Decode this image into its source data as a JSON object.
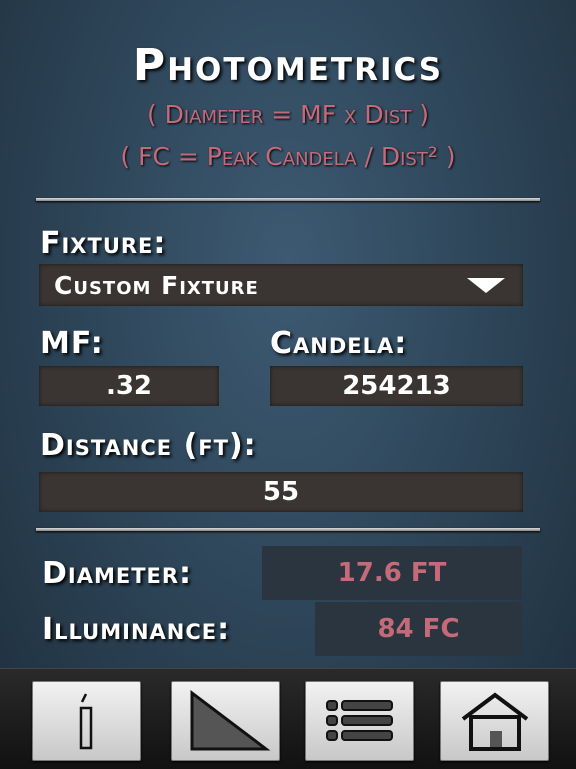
{
  "header": {
    "title": "Photometrics",
    "formula_diameter": "( Diameter = MF x Dist )",
    "formula_fc": "( FC = Peak Candela / Dist² )"
  },
  "fixture": {
    "label": "Fixture:",
    "selected": "Custom Fixture"
  },
  "mf": {
    "label": "MF:",
    "value": ".32"
  },
  "candela": {
    "label": "Candela:",
    "value": "254213"
  },
  "distance": {
    "label": "Distance (ft):",
    "value": "55"
  },
  "results": {
    "diameter_label": "Diameter:",
    "diameter_value": "17.6 FT",
    "illuminance_label": "Illuminance:",
    "illuminance_value": "84 FC"
  },
  "toolbar": {
    "buttons": [
      {
        "icon": "info-icon"
      },
      {
        "icon": "triangle-icon"
      },
      {
        "icon": "list-icon"
      },
      {
        "icon": "home-icon"
      }
    ]
  },
  "colors": {
    "accent": "#c46a79",
    "field_bg": "#3a3533",
    "result_bg": "#2b3540"
  }
}
